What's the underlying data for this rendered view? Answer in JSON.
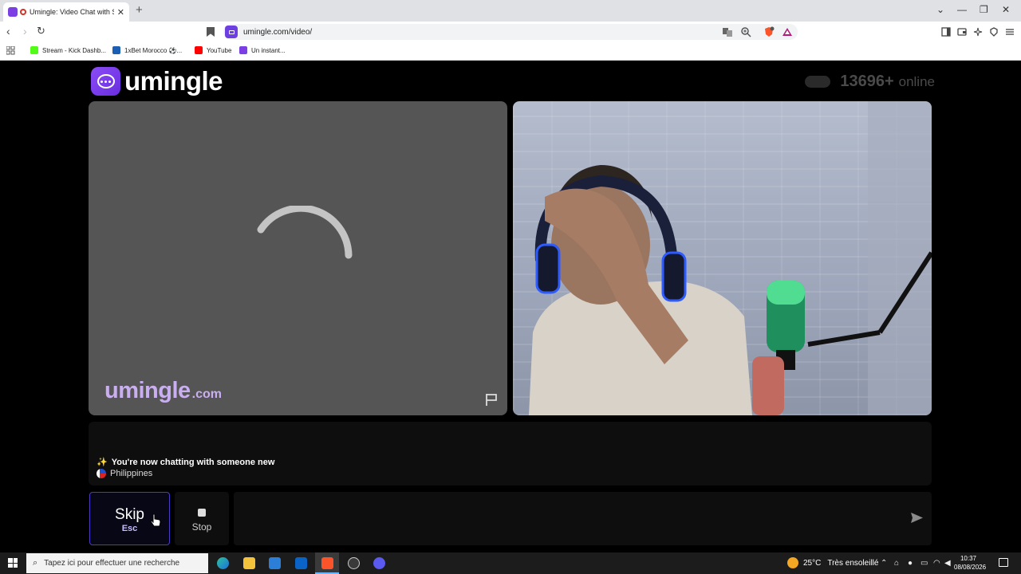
{
  "browser": {
    "tab_title": "Umingle: Video Chat with Str",
    "tab_close": "✕",
    "new_tab": "+",
    "url": "umingle.com/video/",
    "bookmarks": [
      {
        "label": "Stream - Kick Dashb...",
        "color": "#53fc18"
      },
      {
        "label": "1xBet Morocco ⚽...",
        "color": "#1a5fb4"
      },
      {
        "label": "YouTube",
        "color": "#ff0000"
      },
      {
        "label": "Un instant...",
        "color": "#7b3fe4"
      }
    ]
  },
  "header": {
    "logo_text": "umingle",
    "online_count": "13696+",
    "online_label": "online"
  },
  "stranger_video": {
    "watermark_main": "umingle",
    "watermark_suffix": ".com"
  },
  "chat": {
    "sparkle": "✨",
    "status_message": "You're now chatting with someone new",
    "country": "Philippines"
  },
  "controls": {
    "skip_label": "Skip",
    "skip_hotkey": "Esc",
    "stop_label": "Stop",
    "message_placeholder": ""
  },
  "taskbar": {
    "search_placeholder": "Tapez ici pour effectuer une recherche",
    "temperature": "25°C",
    "weather": "Très ensoleillé",
    "time": "10:37",
    "date": "08/08/2026"
  },
  "colors": {
    "brand_purple": "#7b3fe4",
    "skip_border": "#4b3ac8"
  }
}
